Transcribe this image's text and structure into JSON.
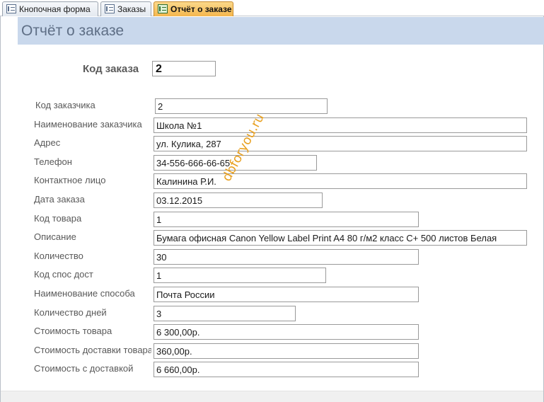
{
  "tabs": [
    {
      "label": "Кнопочная форма",
      "active": false,
      "icon": "form-icon"
    },
    {
      "label": "Заказы",
      "active": false,
      "icon": "form-icon"
    },
    {
      "label": "Отчёт о заказе",
      "active": true,
      "icon": "report-icon"
    }
  ],
  "report": {
    "title": "Отчёт о заказе",
    "order_label": "Код заказа",
    "order_value": "2"
  },
  "fields": [
    {
      "label": "Код заказчика",
      "value": "2"
    },
    {
      "label": "Наименование заказчика",
      "value": "Школа №1"
    },
    {
      "label": "Адрес",
      "value": "ул. Кулика, 287"
    },
    {
      "label": "Телефон",
      "value": "34-556-666-66-65"
    },
    {
      "label": "Контактное лицо",
      "value": "Калинина Р.И."
    },
    {
      "label": "Дата заказа",
      "value": "03.12.2015"
    },
    {
      "label": "Код товара",
      "value": "1"
    },
    {
      "label": "Описание",
      "value": "Бумага офисная Canon Yellow Label Print A4 80 г/м2 класс C+ 500 листов Белая"
    },
    {
      "label": "Количество",
      "value": "30"
    },
    {
      "label": "Код спос дост",
      "value": "1"
    },
    {
      "label": "Наименование способа",
      "value": "Почта России"
    },
    {
      "label": "Количество дней",
      "value": "3"
    },
    {
      "label": "Стоимость товара",
      "value": "6 300,00р."
    },
    {
      "label": "Стоимость доставки товара",
      "value": "360,00р."
    },
    {
      "label": "Стоимость с доставкой",
      "value": "6 660,00р."
    }
  ],
  "watermark": "dbforyou.ru",
  "colors": {
    "header_band": "#c9d8ec",
    "active_tab": "#f4b64d",
    "watermark": "#e8a020"
  }
}
